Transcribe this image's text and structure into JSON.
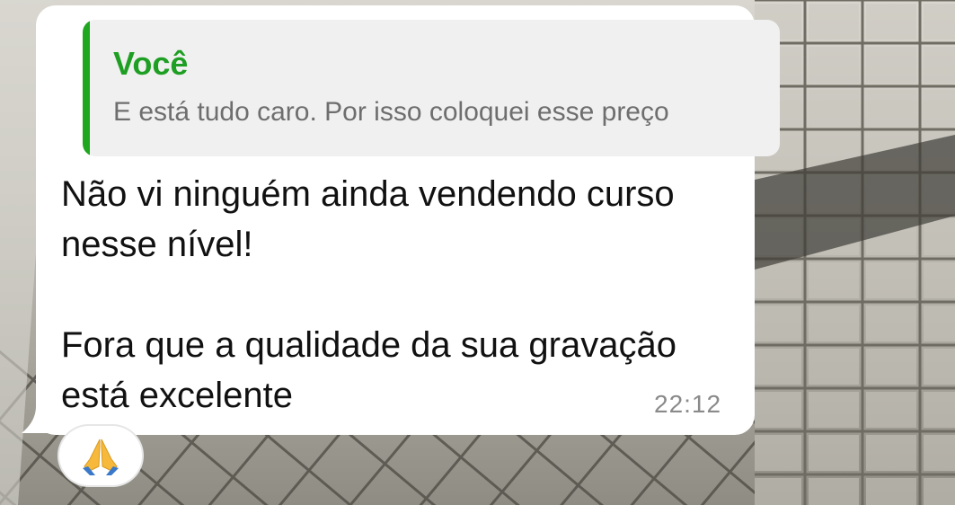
{
  "chat": {
    "reply": {
      "author": "Você",
      "text": "E está tudo caro. Por isso coloquei esse preço"
    },
    "message": {
      "line1": "Não vi ninguém ainda vendendo curso",
      "line2": "nesse nível!",
      "line3": "Fora que a qualidade da sua gravação",
      "line4": "está excelente",
      "time": "22:12"
    },
    "reaction": {
      "icon": "folded-hands-icon"
    }
  },
  "colors": {
    "accent_green": "#1e9f23",
    "bubble": "#ffffff",
    "quote_background": "#f0f0f0"
  }
}
